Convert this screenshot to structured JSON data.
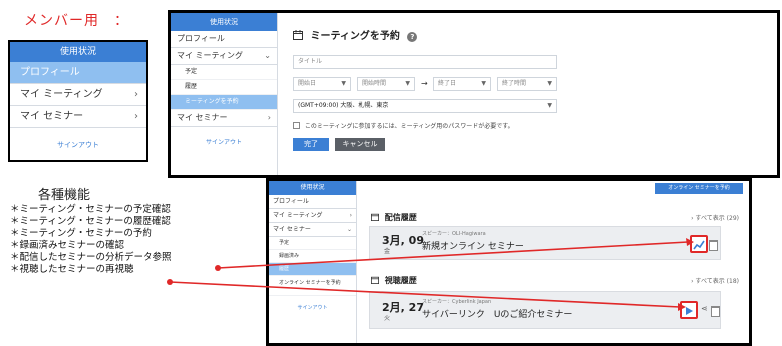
{
  "labels": {
    "member_heading": "メンバー用　：",
    "top_right": "/ ? ?"
  },
  "panel1": {
    "header": "使用状況",
    "items": [
      {
        "label": "プロフィール",
        "chevron": ""
      },
      {
        "label": "マイ ミーティング",
        "chevron": "›"
      },
      {
        "label": "マイ セミナー",
        "chevron": "›"
      }
    ],
    "sign_out": "サインアウト"
  },
  "panel2": {
    "sidebar": {
      "header": "使用状況",
      "profile": "プロフィール",
      "my_meeting": "マイ ミーティング",
      "my_meeting_chevron": "⌄",
      "sub": [
        "予定",
        "履歴",
        "ミーティングを予約"
      ],
      "my_seminar": "マイ セミナー",
      "my_seminar_chevron": "›",
      "sign_out": "サインアウト"
    },
    "form": {
      "title": "ミーティングを予約",
      "help_icon": "?",
      "title_placeholder": "タイトル",
      "start_date": "開始日",
      "start_time": "開始時間",
      "arrow": "→",
      "end_date": "終了日",
      "end_time": "終了時間",
      "timezone": "(GMT+09:00) 大阪、札幌、東京",
      "password_note": "このミーティングに参加するには、ミーティング用のパスワードが必要です。",
      "submit": "完了",
      "cancel": "キャンセル"
    }
  },
  "features": {
    "title": "各種機能",
    "items": [
      "＊ミーティング・セミナーの予定確認",
      "＊ミーティング・セミナーの履歴確認",
      "＊ミーティング・セミナーの予約",
      "＊録画済みセミナーの確認",
      "＊配信したセミナーの分析データ参照",
      "＊視聴したセミナーの再視聴"
    ]
  },
  "panel3": {
    "sidebar": {
      "header": "使用状況",
      "profile": "プロフィール",
      "my_meeting": "マイ ミーティング",
      "my_meeting_chevron": "›",
      "my_seminar": "マイ セミナー",
      "my_seminar_chevron": "⌄",
      "sub": [
        "予定",
        "録画済み",
        "履歴",
        "オンライン セミナーを予約"
      ],
      "sign_out": "サインアウト"
    },
    "book_button": "オンライン セミナーを予約",
    "delivery": {
      "title": "配信履歴",
      "see_all": "› すべて表示 (29)",
      "date": "3月, 09",
      "day": "金",
      "speaker": "スピーカー：OLI-Hagiwara",
      "seminar_title": "新規オンライン セミナー"
    },
    "viewing": {
      "title": "視聴履歴",
      "see_all": "› すべて表示 (18)",
      "date": "2月, 27",
      "day": "火",
      "speaker": "スピーカー：Cyberlink Japan",
      "seminar_title": "サイバーリンク　Uのご紹介セミナー"
    }
  },
  "colors": {
    "accent": "#3b7fd4",
    "active_item": "#8fbff0",
    "highlight": "#e02828"
  },
  "icons": [
    "calendar-icon",
    "help-icon",
    "chart-icon",
    "play-icon",
    "share-icon",
    "trash-icon",
    "chevron-right-icon",
    "chevron-down-icon"
  ]
}
